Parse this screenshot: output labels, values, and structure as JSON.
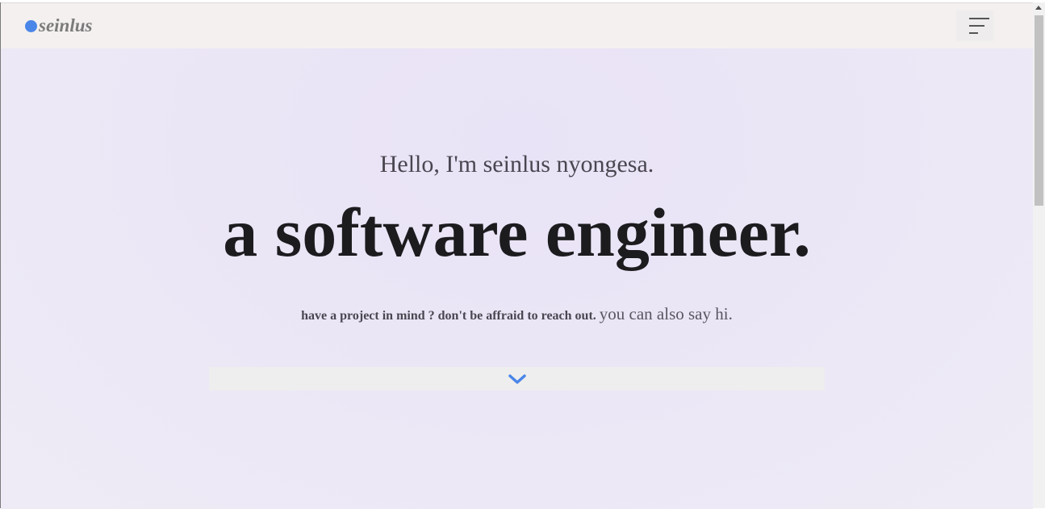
{
  "nav": {
    "logo_text": "seinlus",
    "brand_color": "#4a86e8"
  },
  "hero": {
    "greeting": "Hello, I'm seinlus nyongesa.",
    "headline": "a software engineer.",
    "subline_bold": "have a project in mind ? don't be affraid to reach out.",
    "subline_link": "you can also say hi.",
    "scroll_icon": "chevron-down-icon"
  },
  "icons": {
    "menu": "hamburger-menu-icon",
    "logo_dot": "dot-icon"
  }
}
